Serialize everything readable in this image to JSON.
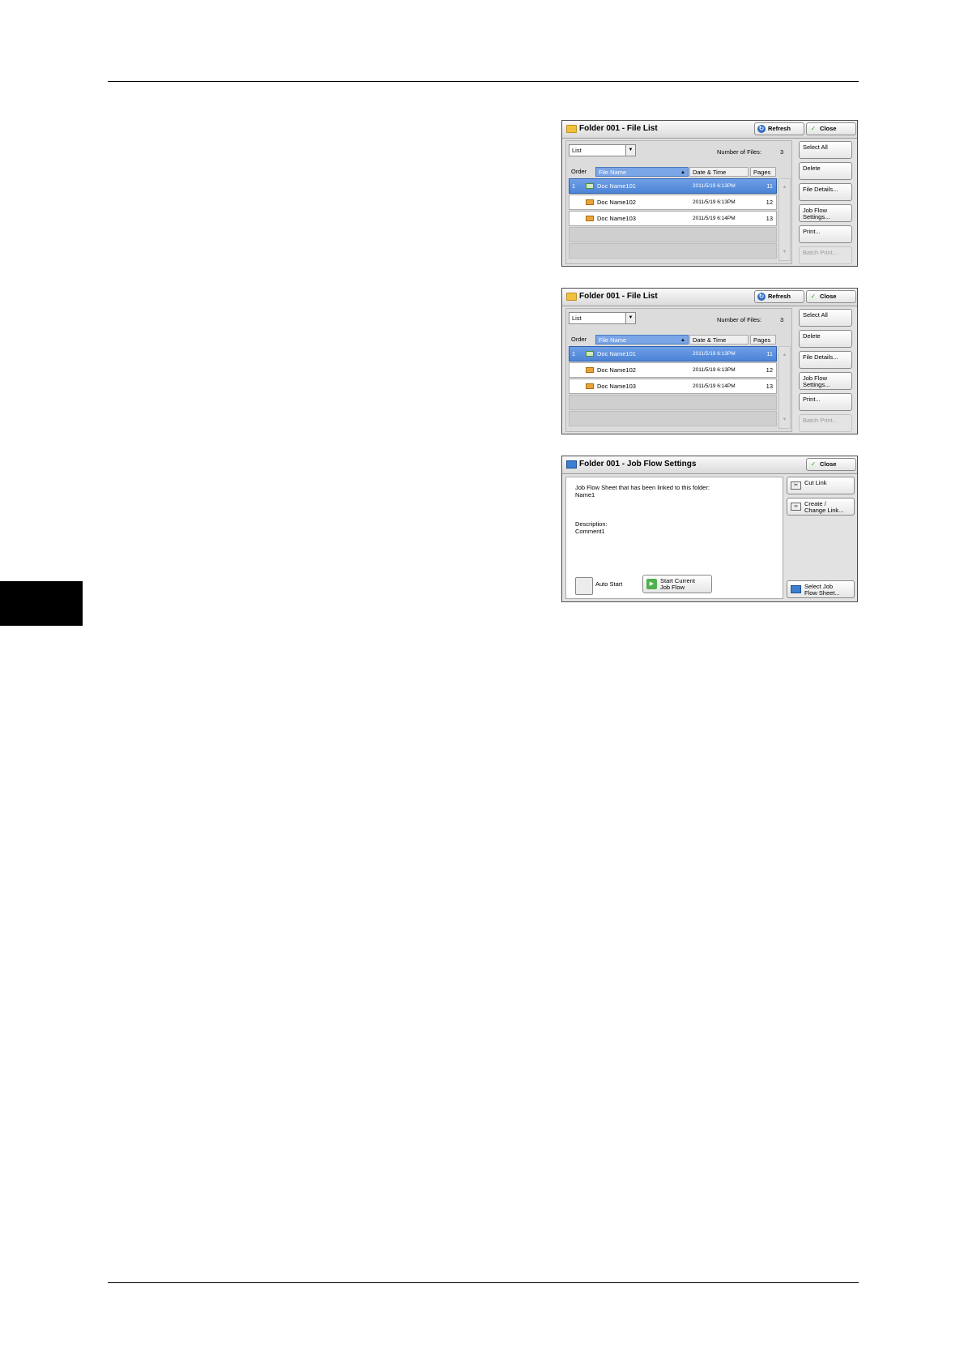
{
  "file_list_screen": {
    "title": "Folder 001 - File List",
    "refresh_label": "Refresh",
    "close_label": "Close",
    "view_select": "List",
    "number_of_files_label": "Number of Files:",
    "number_of_files": "3",
    "columns": {
      "order": "Order",
      "file_name": "File Name",
      "date_time": "Date & Time",
      "pages": "Pages"
    },
    "rows": [
      {
        "order": "1",
        "name": "Doc Name101",
        "date": "2011/5/19 6:13PM",
        "pages": "11"
      },
      {
        "order": "",
        "name": "Doc Name102",
        "date": "2011/5/19 6:13PM",
        "pages": "12"
      },
      {
        "order": "",
        "name": "Doc Name103",
        "date": "2011/5/19 6:14PM",
        "pages": "13"
      }
    ],
    "side_buttons": {
      "select_all": "Select All",
      "delete": "Delete",
      "file_details": "File Details...",
      "job_flow_settings": "Job Flow\nSettings...",
      "print": "Print...",
      "batch_print": "Batch Print..."
    }
  },
  "job_flow_screen": {
    "title": "Folder 001 - Job Flow Settings",
    "close_label": "Close",
    "linked_label": "Job Flow Sheet that has been linked to this folder:",
    "linked_name": "Name1",
    "description_label": "Description:",
    "description_value": "Comment1",
    "auto_start_label": "Auto Start",
    "start_current_label": "Start Current\nJob Flow",
    "cut_link_label": "Cut Link",
    "create_change_link_label": "Create /\nChange Link...",
    "select_job_flow_sheet_label": "Select Job\nFlow Sheet..."
  },
  "colors": {
    "selection": "#4c84d6",
    "folder": "#f2c040"
  }
}
